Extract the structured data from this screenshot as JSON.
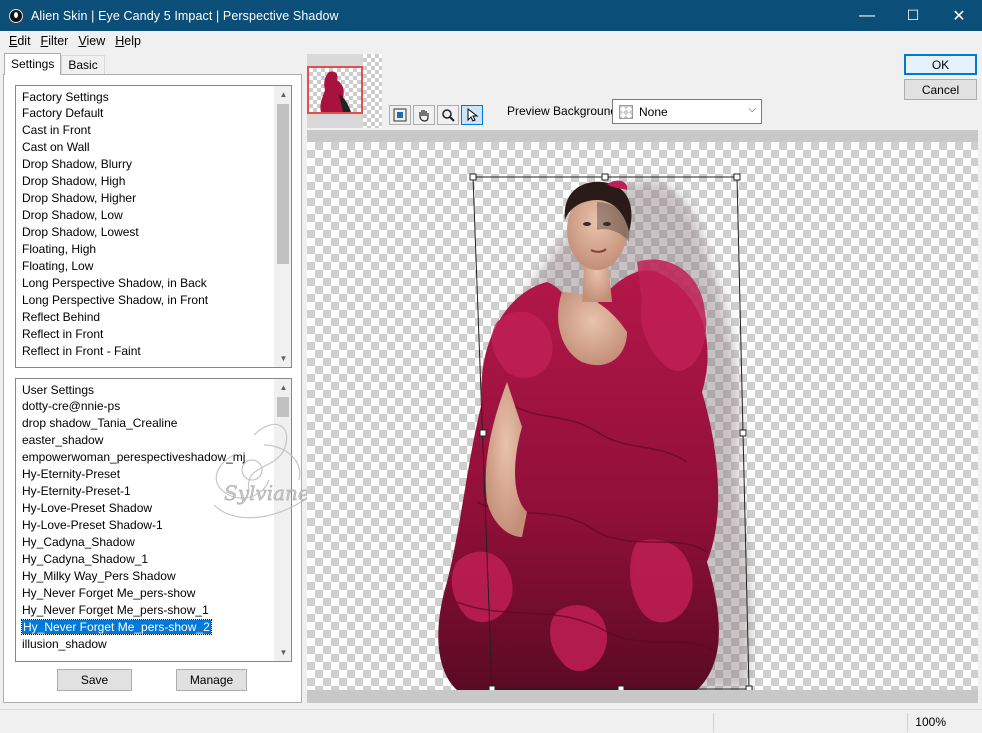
{
  "window": {
    "title": "Alien Skin | Eye Candy 5 Impact | Perspective Shadow",
    "minimize": "—",
    "maximize": "☐",
    "close": "✕"
  },
  "menu": {
    "edit": "dit",
    "edit_first": "E",
    "filter": "ilter",
    "filter_first": "F",
    "view": "iew",
    "view_first": "V",
    "help": "elp",
    "help_first": "H"
  },
  "tabs": {
    "settings": "Settings",
    "basic": "Basic"
  },
  "factory": {
    "header": "Factory Settings",
    "items": [
      "Factory Default",
      "Cast in Front",
      "Cast on Wall",
      "Drop Shadow, Blurry",
      "Drop Shadow, High",
      "Drop Shadow, Higher",
      "Drop Shadow, Low",
      "Drop Shadow, Lowest",
      "Floating, High",
      "Floating, Low",
      "Long Perspective Shadow, in Back",
      "Long Perspective Shadow, in Front",
      "Reflect Behind",
      "Reflect in Front",
      "Reflect in Front - Faint"
    ]
  },
  "user": {
    "header": "User Settings",
    "items": [
      "dotty-cre@nnie-ps",
      "drop shadow_Tania_Crealine",
      "easter_shadow",
      "empowerwoman_perespectiveshadow_mj",
      "Hy-Eternity-Preset",
      "Hy-Eternity-Preset-1",
      "Hy-Love-Preset Shadow",
      "Hy-Love-Preset Shadow-1",
      "Hy_Cadyna_Shadow",
      "Hy_Cadyna_Shadow_1",
      "Hy_Milky Way_Pers Shadow",
      "Hy_Never Forget Me_pers-show",
      "Hy_Never Forget Me_pers-show_1",
      "Hy_Never Forget Me_pers-show_2",
      "illusion_shadow"
    ],
    "selected_index": 13
  },
  "buttons": {
    "save": "Save",
    "manage": "Manage",
    "ok": "OK",
    "cancel": "Cancel"
  },
  "preview_background": {
    "label": "Preview Background:",
    "value": "None"
  },
  "watermark": "Sylviane",
  "status": {
    "zoom": "100%"
  },
  "colors": {
    "titlebar": "#0b4e78",
    "selection": "#0078d7",
    "dress": "#a8123f"
  }
}
